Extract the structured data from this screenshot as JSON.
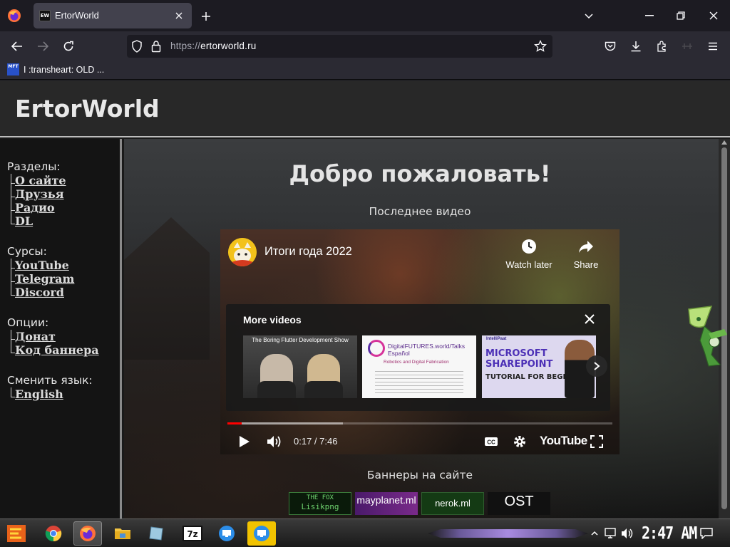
{
  "browser": {
    "tab_title": "ErtorWorld",
    "tab_favicon_text": "EW",
    "url_protocol": "https://",
    "url_host": "ertorworld.ru",
    "bookmark_label": "I :transheart: OLD ...",
    "bookmark_icon_text": "MFT"
  },
  "site": {
    "title": "ErtorWorld",
    "welcome": "Добро пожаловать!",
    "latest_video_label": "Последнее видео",
    "banners_label": "Баннеры на сайте"
  },
  "sidebar": {
    "sections": [
      {
        "heading": "Разделы:",
        "items": [
          "О сайте",
          "Друзья",
          "Радио",
          "DL"
        ]
      },
      {
        "heading": "Сурсы:",
        "items": [
          "YouTube",
          "Telegram",
          "Discord"
        ]
      },
      {
        "heading": "Опции:",
        "items": [
          "Донат",
          "Код баннера"
        ]
      },
      {
        "heading": "Сменить язык:",
        "items": [
          "English"
        ]
      }
    ]
  },
  "video": {
    "title": "Итоги года 2022",
    "watch_later": "Watch later",
    "share": "Share",
    "more_videos": "More videos",
    "thumb1_caption": "The Boring Flutter Development Show",
    "thumb2_caption": "DigitalFUTURES.world/Talks Español",
    "thumb2_sub": "Robotics and Digital Fabrication",
    "thumb3_brand": "IntelliPaat",
    "thumb3_big": "MICROSOFT SHAREPOINT",
    "thumb3_small": "TUTORIAL FOR BEGINNERS",
    "time": "0:17 / 7:46",
    "played_fraction": 0.037,
    "loaded_fraction": 0.3,
    "youtube_label": "YouTube"
  },
  "banners": {
    "b1_line1": "THE FOX",
    "b1_line2": "Lisikpng",
    "b2": "mayplanet.ml",
    "b3": "nerok.ml",
    "b4": "OST"
  },
  "taskbar": {
    "clock": "2:47 AM",
    "sevenzip_label": "7z"
  },
  "colors": {
    "browser_bg": "#1c1b22",
    "toolbar_bg": "#2b2a33",
    "yt_red": "#ff0000",
    "taskbar_accent": "#a88be0",
    "mascot_green": "#b8e07a"
  }
}
